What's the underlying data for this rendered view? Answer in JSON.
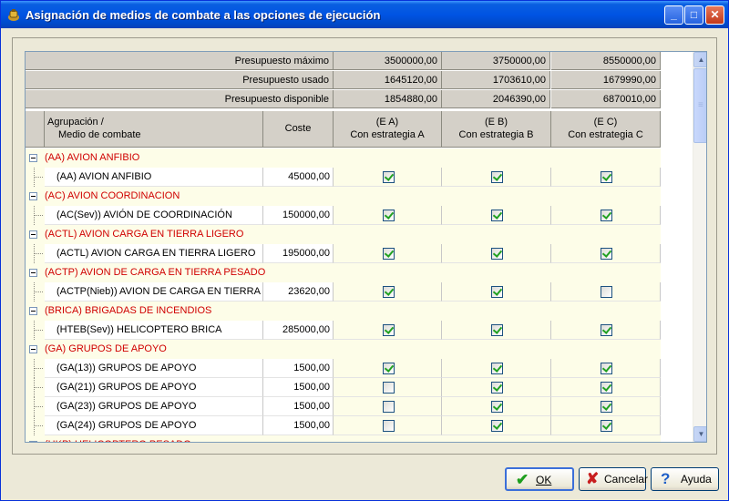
{
  "window": {
    "title": "Asignación de medios de combate a las opciones de ejecución",
    "buttons": {
      "minimize": "_",
      "maximize": "□",
      "close": "✕"
    }
  },
  "budget": {
    "rows": [
      {
        "label": "Presupuesto máximo",
        "values": [
          "3500000,00",
          "3750000,00",
          "8550000,00"
        ]
      },
      {
        "label": "Presupuesto usado",
        "values": [
          "1645120,00",
          "1703610,00",
          "1679990,00"
        ]
      },
      {
        "label": "Presupuesto disponible",
        "values": [
          "1854880,00",
          "2046390,00",
          "6870010,00"
        ]
      }
    ]
  },
  "columns": {
    "group": [
      "Agrupación /",
      "Medio de combate"
    ],
    "cost": "Coste",
    "options": [
      {
        "line1": "(E A)",
        "line2": "Con estrategia A"
      },
      {
        "line1": "(E B)",
        "line2": "Con estrategia B"
      },
      {
        "line1": "(E C)",
        "line2": "Con estrategia C"
      }
    ]
  },
  "groups": [
    {
      "label": "(AA) AVION ANFIBIO",
      "items": [
        {
          "name": "(AA) AVION ANFIBIO",
          "cost": "45000,00",
          "checks": [
            true,
            true,
            true
          ]
        }
      ]
    },
    {
      "label": "(AC) AVION COORDINACION",
      "items": [
        {
          "name": "(AC(Sev)) AVIÓN DE COORDINACIÓN",
          "cost": "150000,00",
          "checks": [
            true,
            true,
            true
          ]
        }
      ]
    },
    {
      "label": "(ACTL) AVION CARGA EN TIERRA LIGERO",
      "items": [
        {
          "name": "(ACTL) AVION CARGA EN TIERRA LIGERO",
          "cost": "195000,00",
          "checks": [
            true,
            true,
            true
          ]
        }
      ]
    },
    {
      "label": "(ACTP) AVION DE CARGA EN TIERRA PESADO",
      "items": [
        {
          "name": "(ACTP(Nieb)) AVION DE CARGA EN TIERRA",
          "cost": "23620,00",
          "checks": [
            true,
            true,
            false
          ]
        }
      ]
    },
    {
      "label": "(BRICA) BRIGADAS DE INCENDIOS",
      "items": [
        {
          "name": "(HTEB(Sev)) HELICOPTERO BRICA",
          "cost": "285000,00",
          "checks": [
            true,
            true,
            true
          ]
        }
      ]
    },
    {
      "label": "(GA) GRUPOS DE APOYO",
      "items": [
        {
          "name": "(GA(13)) GRUPOS DE APOYO",
          "cost": "1500,00",
          "checks": [
            true,
            true,
            true
          ]
        },
        {
          "name": "(GA(21)) GRUPOS DE APOYO",
          "cost": "1500,00",
          "checks": [
            false,
            true,
            true
          ]
        },
        {
          "name": "(GA(23)) GRUPOS DE APOYO",
          "cost": "1500,00",
          "checks": [
            false,
            true,
            true
          ]
        },
        {
          "name": "(GA(24)) GRUPOS DE APOYO",
          "cost": "1500,00",
          "checks": [
            false,
            true,
            true
          ]
        }
      ]
    },
    {
      "label": "(HKP) HELICOPTERO PESADO",
      "items": []
    }
  ],
  "scrollbar": {
    "up": "▲",
    "down": "▼"
  },
  "footer": {
    "ok": {
      "label": "OK",
      "icon": "checkmark-icon",
      "glyph": "✔",
      "color": "#1e9e1e"
    },
    "cancel": {
      "label": "Cancelar",
      "icon": "cross-icon",
      "glyph": "✘",
      "color": "#c81e1e"
    },
    "help": {
      "label": "Ayuda",
      "icon": "help-icon",
      "glyph": "?",
      "color": "#1f5fc8"
    }
  },
  "colors": {
    "group_text": "#d00000",
    "title_bar": "#0054e3",
    "check": "#21a121"
  }
}
